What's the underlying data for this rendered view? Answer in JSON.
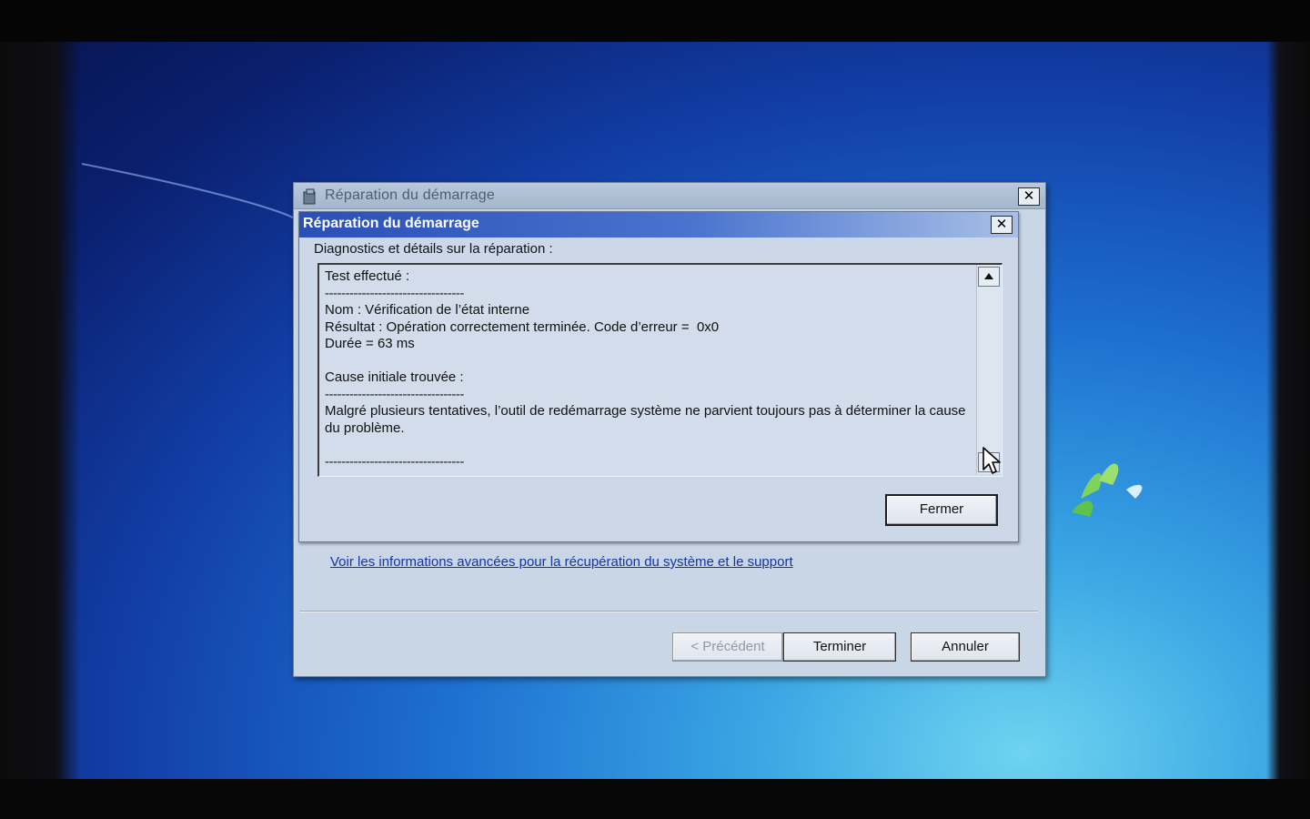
{
  "outer_window": {
    "title": "Réparation du démarrage",
    "close_label": "✕"
  },
  "inner_dialog": {
    "title": "Réparation du démarrage",
    "close_label": "✕",
    "diagnostics_label": "Diagnostics et détails sur la réparation :",
    "details": {
      "test_header": "Test effectué :",
      "separator": "----------------------------------",
      "name_line": "Nom : Vérification de l’état interne",
      "result_line": "Résultat : Opération correctement terminée. Code d’erreur =  0x0",
      "duration_line": "Durée = 63 ms",
      "cause_header": "Cause initiale trouvée :",
      "cause_text": "Malgré plusieurs tentatives, l’outil de redémarrage système ne parvient toujours pas à déterminer la cause du problème."
    },
    "close_button_label": "Fermer"
  },
  "advanced_link_text": "Voir les informations avancées pour la récupération du système et le support",
  "wizard_buttons": {
    "previous_label": "< Précédent",
    "finish_label": "Terminer",
    "cancel_label": "Annuler"
  },
  "colors": {
    "desktop_blue": "#123fa8",
    "title_bar_blue": "#2a4fb8",
    "link_blue": "#1533a8",
    "dialog_bg": "#ccd8e7"
  },
  "icons": [
    "app-icon",
    "close-icon",
    "scroll-up-icon",
    "scroll-down-icon",
    "mouse-cursor-icon"
  ]
}
